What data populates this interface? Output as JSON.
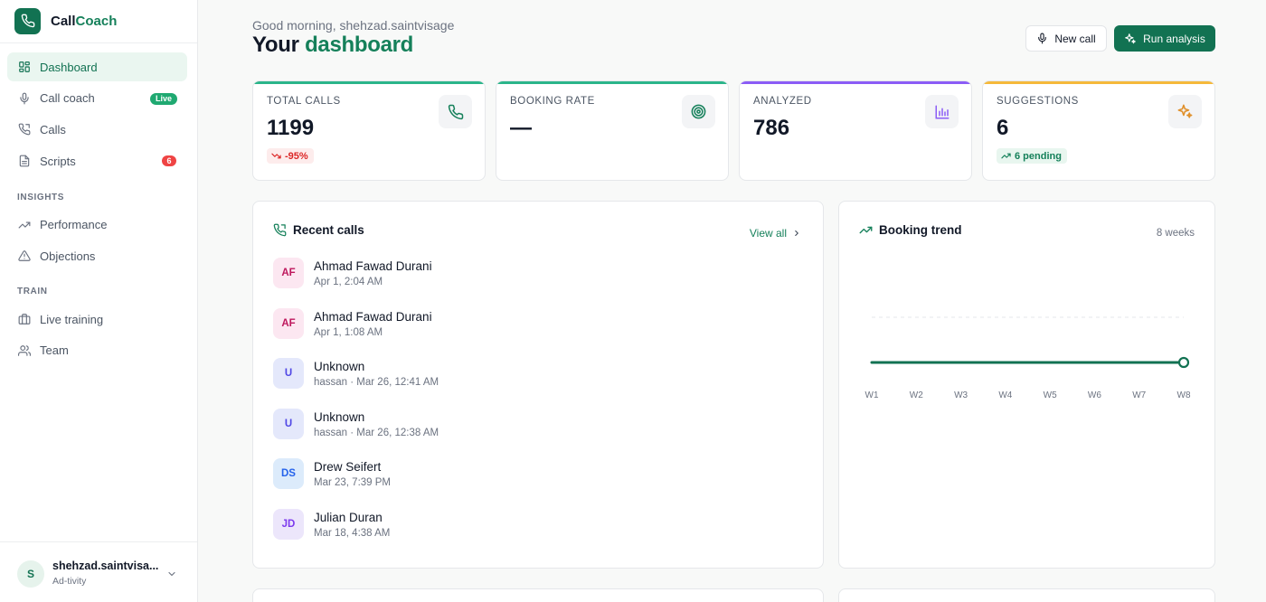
{
  "brand": {
    "name_prefix": "Call",
    "name_accent": "Coach"
  },
  "sidebar": {
    "items": [
      {
        "label": "Dashboard",
        "icon": "grid-icon",
        "active": true
      },
      {
        "label": "Call coach",
        "icon": "mic-icon",
        "badge": "Live"
      },
      {
        "label": "Calls",
        "icon": "phone-icon"
      },
      {
        "label": "Scripts",
        "icon": "file-text-icon",
        "badge": "6"
      }
    ],
    "sections": [
      {
        "title": "INSIGHTS",
        "items": [
          {
            "label": "Performance",
            "icon": "trending-up-icon"
          },
          {
            "label": "Objections",
            "icon": "alert-triangle-icon"
          }
        ]
      },
      {
        "title": "TRAIN",
        "items": [
          {
            "label": "Live training",
            "icon": "briefcase-icon"
          },
          {
            "label": "Team",
            "icon": "users-icon"
          }
        ]
      }
    ],
    "user": {
      "initial": "S",
      "name": "shehzad.saintvisa...",
      "org": "Ad-tivity"
    }
  },
  "header": {
    "greeting": "Good morning, shehzad.saintvisage",
    "title_prefix": "Your",
    "title_accent": "dashboard",
    "new_call_label": "New call",
    "run_analysis_label": "Run analysis"
  },
  "stats": [
    {
      "label": "TOTAL CALLS",
      "value": "1199",
      "delta": "-95%",
      "delta_type": "negative",
      "accent": "#2bb58a",
      "icon": "phone-icon"
    },
    {
      "label": "BOOKING RATE",
      "value": "—",
      "accent": "#2bb58a",
      "icon": "target-icon"
    },
    {
      "label": "ANALYZED",
      "value": "786",
      "accent": "#8b5cf6",
      "icon": "bar-chart-icon"
    },
    {
      "label": "SUGGESTIONS",
      "value": "6",
      "delta": "6 pending",
      "delta_type": "positive",
      "accent": "#f5b93b",
      "icon": "sparkles-icon"
    }
  ],
  "recent_calls": {
    "title": "Recent calls",
    "view_all": "View all",
    "rows": [
      {
        "initials": "AF",
        "name": "Ahmad Fawad Durani",
        "meta": "Apr 1, 2:04 AM",
        "bg": "#fce7f1",
        "fg": "#be185d"
      },
      {
        "initials": "AF",
        "name": "Ahmad Fawad Durani",
        "meta": "Apr 1, 1:08 AM",
        "bg": "#fce7f1",
        "fg": "#be185d"
      },
      {
        "initials": "U",
        "name": "Unknown",
        "meta": "hassan · Mar 26, 12:41 AM",
        "bg": "#e4e8fb",
        "fg": "#4f46e5"
      },
      {
        "initials": "U",
        "name": "Unknown",
        "meta": "hassan · Mar 26, 12:38 AM",
        "bg": "#e4e8fb",
        "fg": "#4f46e5"
      },
      {
        "initials": "DS",
        "name": "Drew Seifert",
        "meta": "Mar 23, 7:39 PM",
        "bg": "#dcebfb",
        "fg": "#2563eb"
      },
      {
        "initials": "JD",
        "name": "Julian Duran",
        "meta": "Mar 18, 4:38 AM",
        "bg": "#ece6fb",
        "fg": "#7c3aed"
      }
    ]
  },
  "booking_trend": {
    "title": "Booking trend",
    "range": "8 weeks"
  },
  "chart_data": {
    "type": "line",
    "categories": [
      "W1",
      "W2",
      "W3",
      "W4",
      "W5",
      "W6",
      "W7",
      "W8"
    ],
    "series": [
      {
        "values": [
          0,
          0,
          0,
          0,
          0,
          0,
          0,
          0
        ]
      }
    ],
    "title": "Booking trend",
    "ylim": [
      0,
      1
    ],
    "grid": true,
    "color": "#127252"
  }
}
